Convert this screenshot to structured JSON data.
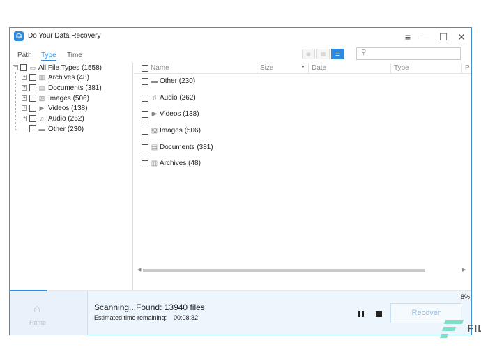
{
  "window": {
    "title": "Do Your Data Recovery"
  },
  "title_buttons": {
    "menu": "≡",
    "minimize": "—",
    "maximize": "☐",
    "close": "✕"
  },
  "tabs": [
    {
      "label": "Path"
    },
    {
      "label": "Type",
      "active": true
    },
    {
      "label": "Time"
    }
  ],
  "search": {
    "value": "",
    "placeholder": ""
  },
  "tree": [
    {
      "label": "All File Types (1558)",
      "icon": "monitor-icon"
    },
    {
      "label": "Archives (48)",
      "icon": "archive-icon"
    },
    {
      "label": "Documents (381)",
      "icon": "document-icon"
    },
    {
      "label": "Images (506)",
      "icon": "image-icon"
    },
    {
      "label": "Videos (138)",
      "icon": "video-icon"
    },
    {
      "label": "Audio (262)",
      "icon": "audio-icon"
    },
    {
      "label": "Other (230)",
      "icon": "folder-icon"
    }
  ],
  "columns": {
    "name": "Name",
    "size": "Size",
    "date": "Date",
    "type": "Type",
    "path": "P"
  },
  "files": [
    {
      "label": "Other (230)",
      "icon": "folder-icon"
    },
    {
      "label": "Audio (262)",
      "icon": "audio-icon"
    },
    {
      "label": "Videos (138)",
      "icon": "video-icon"
    },
    {
      "label": "Images (506)",
      "icon": "image-icon"
    },
    {
      "label": "Documents (381)",
      "icon": "document-icon"
    },
    {
      "label": "Archives (48)",
      "icon": "archive-icon"
    }
  ],
  "status": {
    "scanning": "Scanning...Found: 13940 files",
    "eta_label": "Estimated time remaining:",
    "eta_value": "00:08:32",
    "percent": "8%",
    "progress": 0.08
  },
  "home": {
    "label": "Home"
  },
  "actions": {
    "recover": "Recover"
  },
  "watermark": {
    "text": "FIL"
  },
  "colors": {
    "accent": "#2b8be0",
    "panel": "#eef6fd"
  }
}
